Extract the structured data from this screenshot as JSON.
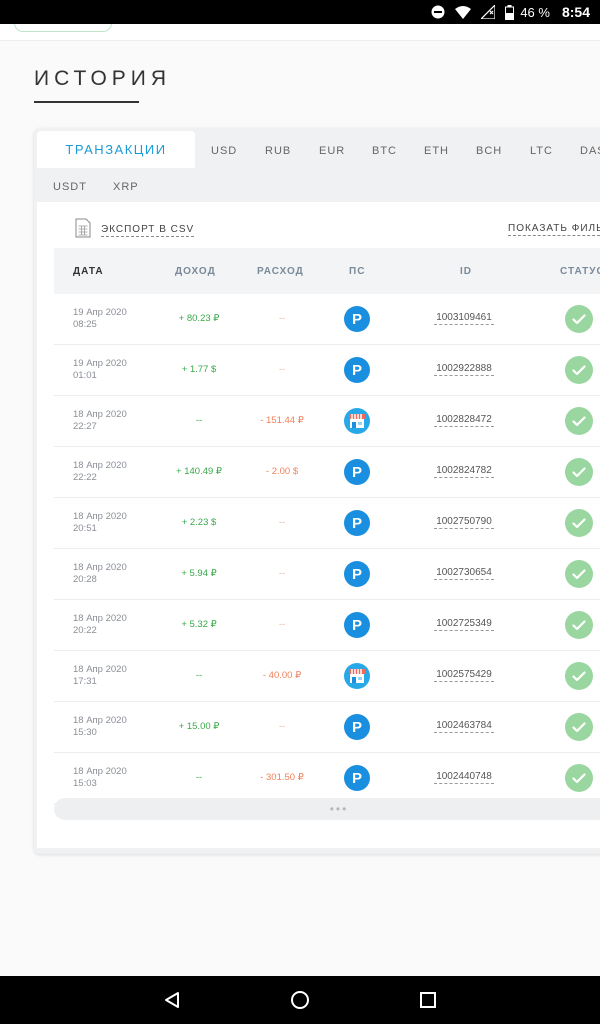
{
  "status_bar": {
    "battery_percent": "46 %",
    "time": "8:54",
    "icons": [
      "minus-circle-icon",
      "wifi-icon",
      "no-signal-icon",
      "battery-icon"
    ]
  },
  "page": {
    "title": "ИСТОРИЯ"
  },
  "tabs_row1": [
    {
      "label": "ТРАНЗАКЦИИ",
      "active": true
    },
    {
      "label": "USD"
    },
    {
      "label": "RUB"
    },
    {
      "label": "EUR"
    },
    {
      "label": "BTC"
    },
    {
      "label": "ETH"
    },
    {
      "label": "BCH"
    },
    {
      "label": "LTC"
    },
    {
      "label": "DAS"
    }
  ],
  "tabs_row2": [
    {
      "label": "USDT"
    },
    {
      "label": "XRP"
    }
  ],
  "toolbar": {
    "export_label": "ЭКСПОРТ В CSV",
    "filter_label": "ПОКАЗАТЬ ФИЛЬТ"
  },
  "table": {
    "headers": {
      "date": "ДАТА",
      "income": "ДОХОД",
      "expense": "РАСХОД",
      "ps": "ПС",
      "id": "ID",
      "status": "СТАТУС"
    },
    "rows": [
      {
        "date": "19 Апр 2020",
        "time": "08:25",
        "income": "+ 80.23 ₽",
        "expense": "--",
        "ps": "p",
        "id": "1003109461"
      },
      {
        "date": "19 Апр 2020",
        "time": "01:01",
        "income": "+ 1.77 $",
        "expense": "--",
        "ps": "p",
        "id": "1002922888"
      },
      {
        "date": "18 Апр 2020",
        "time": "22:27",
        "income": "--",
        "expense": "- 151.44 ₽",
        "ps": "shop",
        "id": "1002828472"
      },
      {
        "date": "18 Апр 2020",
        "time": "22:22",
        "income": "+ 140.49 ₽",
        "expense": "- 2.00 $",
        "ps": "p",
        "id": "1002824782"
      },
      {
        "date": "18 Апр 2020",
        "time": "20:51",
        "income": "+ 2.23 $",
        "expense": "--",
        "ps": "p",
        "id": "1002750790"
      },
      {
        "date": "18 Апр 2020",
        "time": "20:28",
        "income": "+ 5.94 ₽",
        "expense": "--",
        "ps": "p",
        "id": "1002730654"
      },
      {
        "date": "18 Апр 2020",
        "time": "20:22",
        "income": "+ 5.32 ₽",
        "expense": "--",
        "ps": "p",
        "id": "1002725349"
      },
      {
        "date": "18 Апр 2020",
        "time": "17:31",
        "income": "--",
        "expense": "- 40.00 ₽",
        "ps": "shop",
        "id": "1002575429"
      },
      {
        "date": "18 Апр 2020",
        "time": "15:30",
        "income": "+ 15.00 ₽",
        "expense": "--",
        "ps": "p",
        "id": "1002463784"
      },
      {
        "date": "18 Апр 2020",
        "time": "15:03",
        "income": "--",
        "expense": "- 301.50 ₽",
        "ps": "p",
        "id": "1002440748"
      }
    ]
  },
  "ps_labels": {
    "p": "P"
  },
  "load_more": {
    "label": "•••"
  },
  "colors": {
    "accent": "#1a9bd7",
    "income": "#3aa94b",
    "expense": "#f0805a",
    "status_ok": "#9ad69f",
    "ps_blue": "#1a8fe0"
  }
}
